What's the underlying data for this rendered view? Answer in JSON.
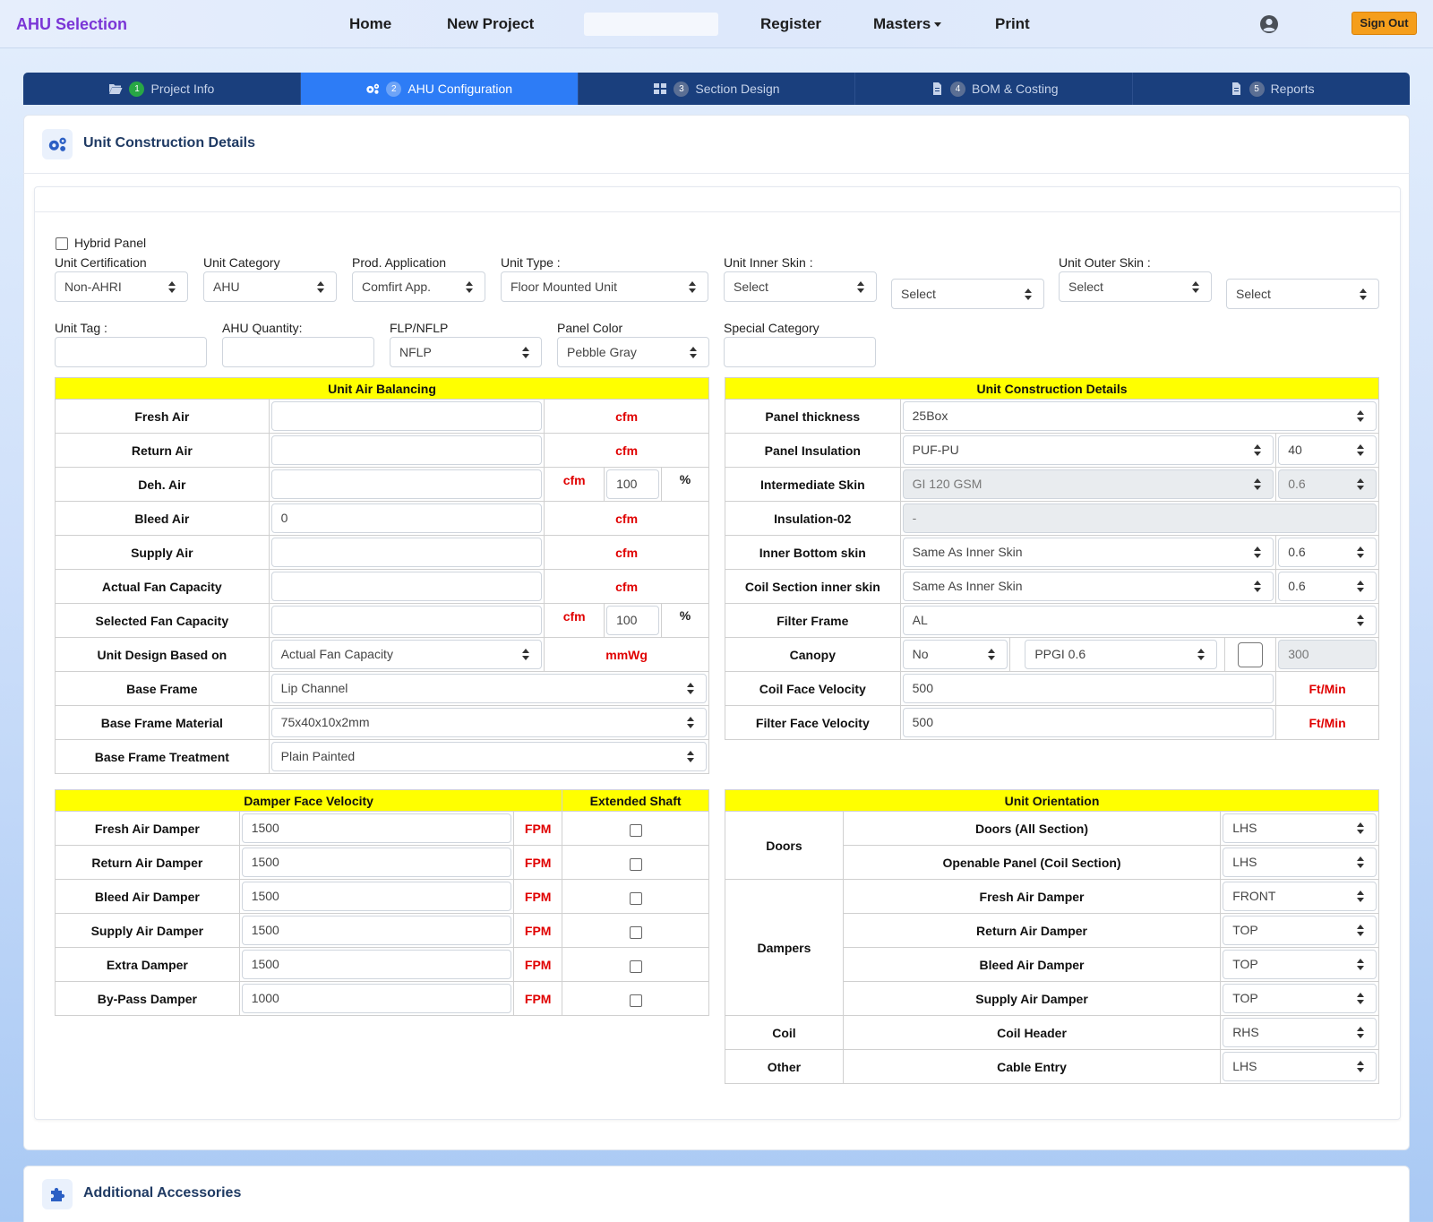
{
  "nav": {
    "brand": "AHU Selection",
    "home": "Home",
    "new_project": "New Project",
    "register": "Register",
    "masters": "Masters",
    "print": "Print",
    "sign_out": "Sign Out"
  },
  "tabs": [
    {
      "num": "1",
      "label": "Project Info",
      "icon": "folder-open-icon"
    },
    {
      "num": "2",
      "label": "AHU Configuration",
      "icon": "cogs-icon"
    },
    {
      "num": "3",
      "label": "Section Design",
      "icon": "grid-icon"
    },
    {
      "num": "4",
      "label": "BOM & Costing",
      "icon": "file-icon"
    },
    {
      "num": "5",
      "label": "Reports",
      "icon": "file-icon"
    }
  ],
  "section": {
    "title": "Unit Construction Details",
    "accessories_title": "Additional Accessories"
  },
  "form": {
    "hybrid_panel": "Hybrid Panel",
    "unit_certification": {
      "label": "Unit Certification",
      "value": "Non-AHRI"
    },
    "unit_category": {
      "label": "Unit Category",
      "value": "AHU"
    },
    "prod_application": {
      "label": "Prod. Application",
      "value": "Comfirt App."
    },
    "unit_type": {
      "label": "Unit Type :",
      "value": "Floor Mounted Unit"
    },
    "unit_inner_skin": {
      "label": "Unit Inner Skin :",
      "value": "Select",
      "value2": "Select"
    },
    "unit_outer_skin": {
      "label": "Unit Outer Skin :",
      "value": "Select",
      "value2": "Select"
    },
    "unit_tag": {
      "label": "Unit Tag :",
      "value": ""
    },
    "ahu_quantity": {
      "label": "AHU Quantity:",
      "value": ""
    },
    "flp_nflp": {
      "label": "FLP/NFLP",
      "value": "NFLP"
    },
    "panel_color": {
      "label": "Panel Color",
      "value": "Pebble Gray"
    },
    "special_category": {
      "label": "Special Category",
      "value": ""
    }
  },
  "air_balancing": {
    "title": "Unit Air Balancing",
    "rows": [
      {
        "label": "Fresh Air",
        "value": "",
        "unit": "cfm"
      },
      {
        "label": "Return Air",
        "value": "",
        "unit": "cfm"
      },
      {
        "label": "Deh. Air",
        "value": "",
        "unit": "cfm",
        "pct": "100",
        "pct_sign": "%"
      },
      {
        "label": "Bleed Air",
        "value": "0",
        "unit": "cfm"
      },
      {
        "label": "Supply Air",
        "value": "",
        "unit": "cfm"
      },
      {
        "label": "Actual Fan Capacity",
        "value": "",
        "unit": "cfm"
      },
      {
        "label": "Selected Fan Capacity",
        "value": "",
        "unit": "cfm",
        "pct": "100",
        "pct_sign": "%"
      },
      {
        "label": "Unit Design Based on",
        "value": "Actual Fan Capacity",
        "unit": "mmWg"
      },
      {
        "label": "Base Frame",
        "value": "Lip Channel"
      },
      {
        "label": "Base Frame Material",
        "value": "75x40x10x2mm"
      },
      {
        "label": "Base Frame Treatment",
        "value": "Plain Painted"
      }
    ]
  },
  "construction": {
    "title": "Unit Construction Details",
    "rows": [
      {
        "label": "Panel thickness",
        "value": "25Box"
      },
      {
        "label": "Panel Insulation",
        "value": "PUF-PU",
        "value2": "40"
      },
      {
        "label": "Intermediate Skin",
        "value": "GI 120 GSM",
        "value2": "0.6"
      },
      {
        "label": "Insulation-02",
        "value": "-"
      },
      {
        "label": "Inner Bottom skin",
        "value": "Same As Inner Skin",
        "value2": "0.6"
      },
      {
        "label": "Coil Section inner skin",
        "value": "Same As Inner Skin",
        "value2": "0.6"
      },
      {
        "label": "Filter Frame",
        "value": "AL"
      },
      {
        "label": "Canopy",
        "value": "No",
        "value2": "PPGI 0.6",
        "value3": "300"
      },
      {
        "label": "Coil Face Velocity",
        "value": "500",
        "unit": "Ft/Min"
      },
      {
        "label": "Filter Face Velocity",
        "value": "500",
        "unit": "Ft/Min"
      }
    ]
  },
  "dampers": {
    "title": "Damper Face Velocity",
    "shaft_title": "Extended Shaft",
    "rows": [
      {
        "label": "Fresh Air Damper",
        "value": "1500",
        "unit": "FPM"
      },
      {
        "label": "Return Air Damper",
        "value": "1500",
        "unit": "FPM"
      },
      {
        "label": "Bleed Air Damper",
        "value": "1500",
        "unit": "FPM"
      },
      {
        "label": "Supply Air Damper",
        "value": "1500",
        "unit": "FPM"
      },
      {
        "label": "Extra Damper",
        "value": "1500",
        "unit": "FPM"
      },
      {
        "label": "By-Pass Damper",
        "value": "1000",
        "unit": "FPM"
      }
    ]
  },
  "orientation": {
    "title": "Unit Orientation",
    "groups": {
      "doors": "Doors",
      "dampers": "Dampers",
      "coil": "Coil",
      "other": "Other"
    },
    "rows": [
      {
        "label": "Doors (All Section)",
        "value": "LHS"
      },
      {
        "label": "Openable Panel (Coil Section)",
        "value": "LHS"
      },
      {
        "label": "Fresh Air Damper",
        "value": "FRONT"
      },
      {
        "label": "Return Air Damper",
        "value": "TOP"
      },
      {
        "label": "Bleed Air Damper",
        "value": "TOP"
      },
      {
        "label": "Supply Air Damper",
        "value": "TOP"
      },
      {
        "label": "Coil Header",
        "value": "RHS"
      },
      {
        "label": "Cable Entry",
        "value": "LHS"
      }
    ]
  }
}
